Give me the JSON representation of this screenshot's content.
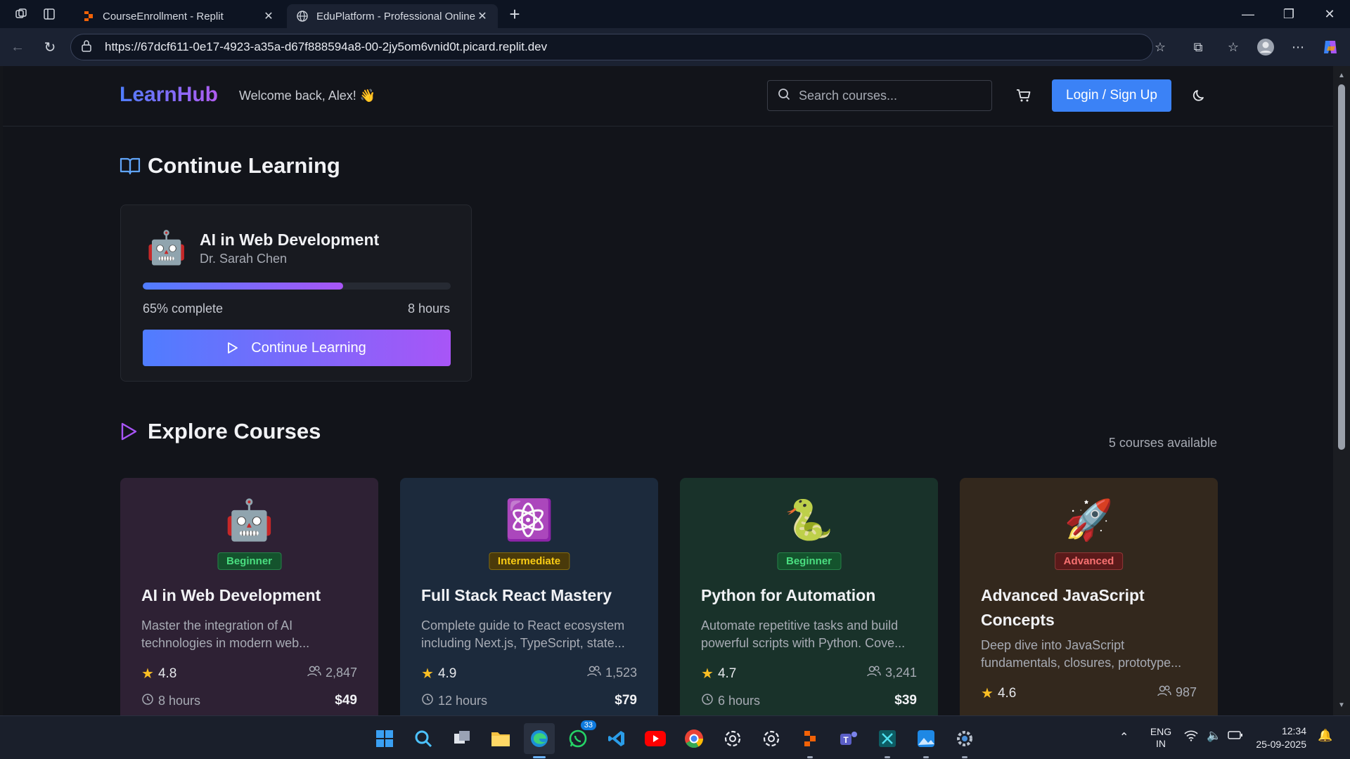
{
  "browser": {
    "tabs": [
      {
        "label": "CourseEnrollment - Replit",
        "active": false
      },
      {
        "label": "EduPlatform - Professional Online",
        "active": true
      }
    ],
    "url": "https://67dcf611-0e17-4923-a35a-d67f888594a8-00-2jy5om6vnid0t.picard.replit.dev"
  },
  "header": {
    "logo": "LearnHub",
    "welcome": "Welcome back, Alex! 👋",
    "search_placeholder": "Search courses...",
    "login_label": "Login / Sign Up"
  },
  "continue_section": {
    "title": "Continue Learning",
    "card": {
      "emoji": "🤖",
      "title": "AI in Web Development",
      "author": "Dr. Sarah Chen",
      "progress_percent": 65,
      "progress_label": "65% complete",
      "hours": "8 hours",
      "button_label": "Continue Learning"
    }
  },
  "explore_section": {
    "title": "Explore Courses",
    "count_label": "5 courses available"
  },
  "courses": [
    {
      "emoji": "🤖",
      "level": "Beginner",
      "title": "AI in Web Development",
      "description": "Master the integration of AI technologies in modern web...",
      "rating": "4.8",
      "students": "2,847",
      "duration": "8 hours",
      "price": "$49",
      "bg": "#2e2134",
      "badge_bg": "#14532d",
      "badge_fg": "#4ade80"
    },
    {
      "emoji": "⚛️",
      "level": "Intermediate",
      "title": "Full Stack React Mastery",
      "description": "Complete guide to React ecosystem including Next.js, TypeScript, state...",
      "rating": "4.9",
      "students": "1,523",
      "duration": "12 hours",
      "price": "$79",
      "bg": "#1c2a3c",
      "badge_bg": "#4a3a0a",
      "badge_fg": "#facc15"
    },
    {
      "emoji": "🐍",
      "level": "Beginner",
      "title": "Python for Automation",
      "description": "Automate repetitive tasks and build powerful scripts with Python. Cove...",
      "rating": "4.7",
      "students": "3,241",
      "duration": "6 hours",
      "price": "$39",
      "bg": "#19322a",
      "badge_bg": "#14532d",
      "badge_fg": "#4ade80"
    },
    {
      "emoji": "🚀",
      "level": "Advanced",
      "title": "Advanced JavaScript Concepts",
      "description": "Deep dive into JavaScript fundamentals, closures, prototype...",
      "rating": "4.6",
      "students": "987",
      "price": "",
      "duration": "",
      "bg": "#33281d",
      "badge_bg": "#5b1a1a",
      "badge_fg": "#f87171"
    }
  ],
  "taskbar": {
    "apps": [
      "windows-start",
      "search",
      "task-view",
      "file-explorer",
      "edge",
      "whatsapp",
      "vscode",
      "youtube",
      "chrome",
      "chatgpt",
      "chatgpt-2",
      "replit",
      "teams",
      "app-blue",
      "photos",
      "settings"
    ],
    "whatsapp_badge": "33",
    "lang_line1": "ENG",
    "lang_line2": "IN",
    "time": "12:34",
    "date": "25-09-2025"
  }
}
